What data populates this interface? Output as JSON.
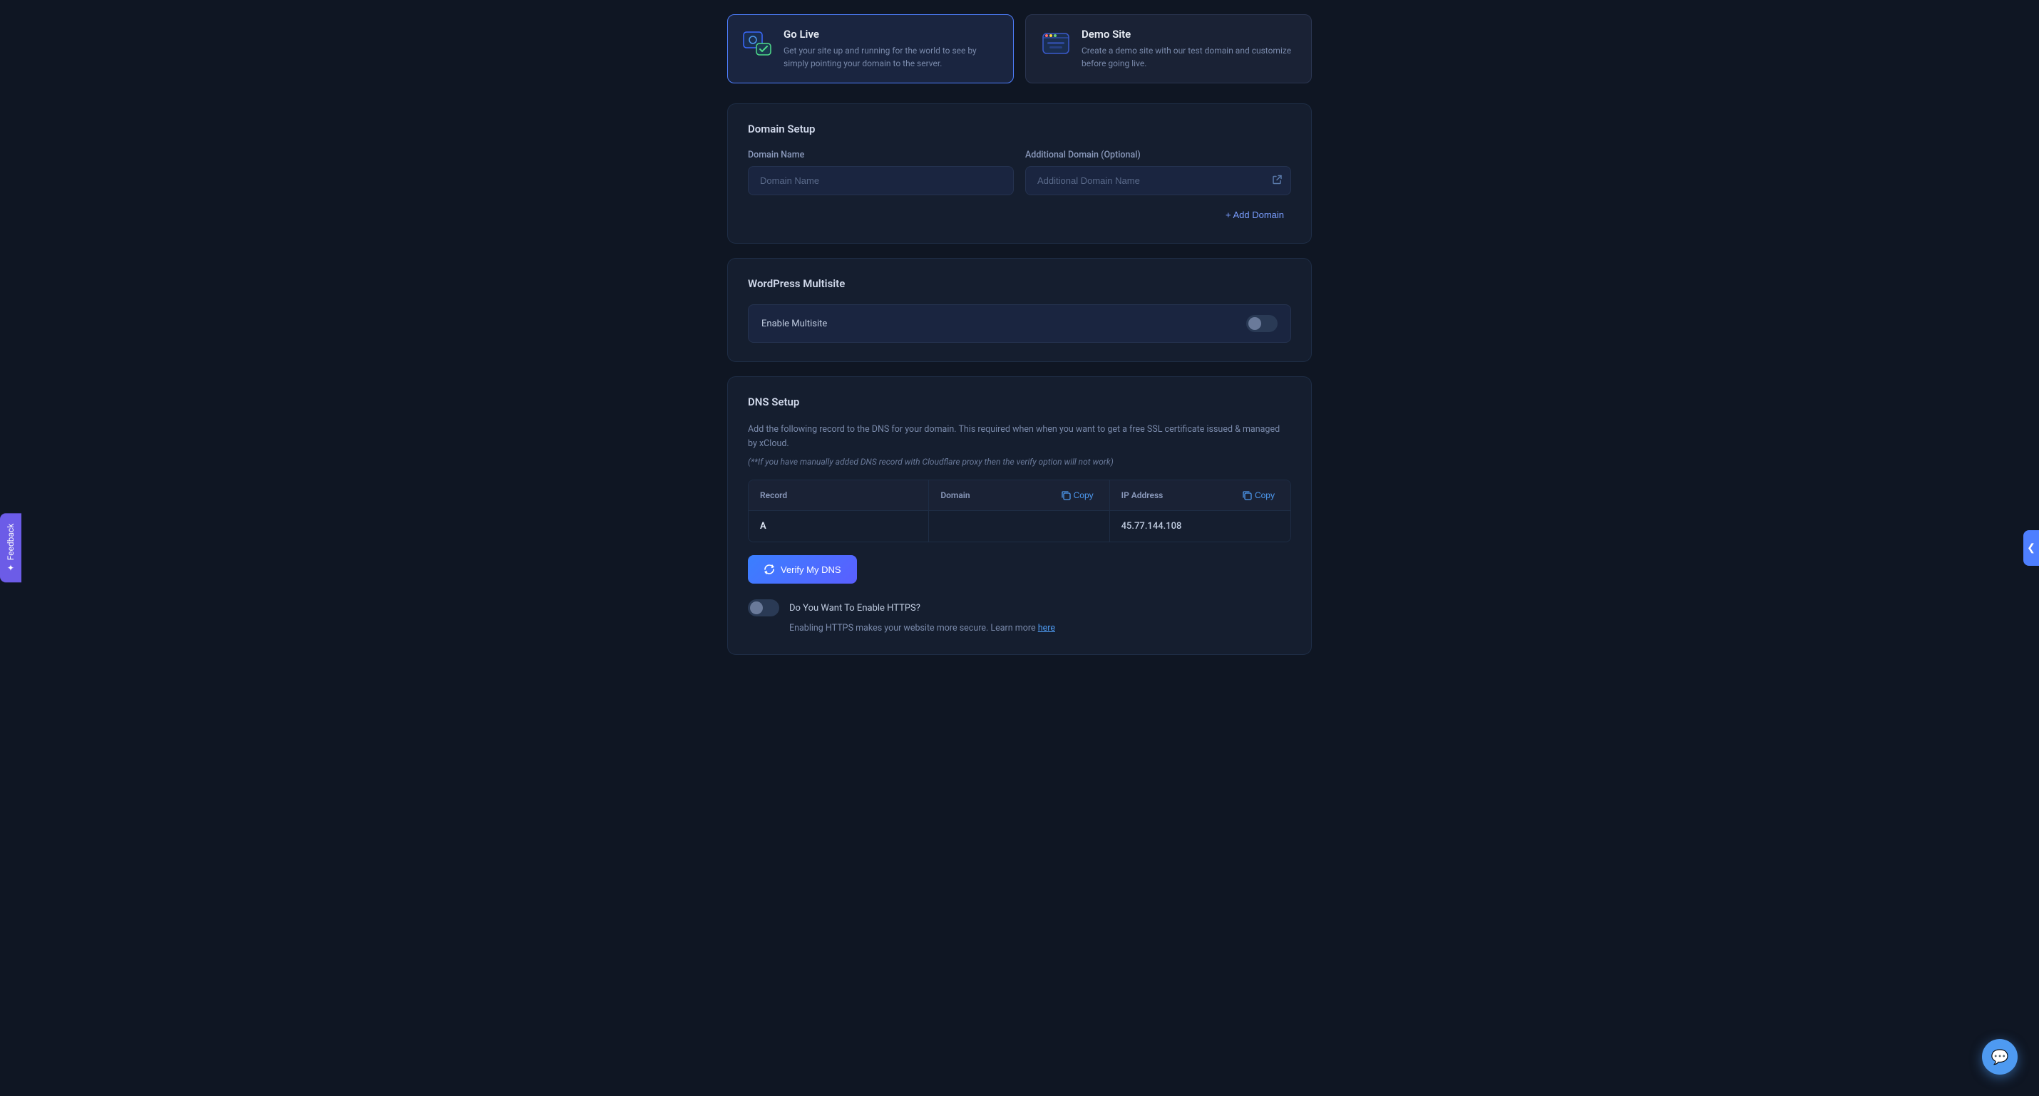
{
  "header": {
    "go_live_card": {
      "title": "Go Live",
      "description": "Get your site up and running for the world to see by simply pointing your domain to the server."
    },
    "demo_site_card": {
      "title": "Demo Site",
      "description": "Create a demo site with our test domain and customize before going live."
    }
  },
  "domain_setup": {
    "section_title": "Domain Setup",
    "domain_name_label": "Domain Name",
    "domain_name_placeholder": "Domain Name",
    "additional_domain_label": "Additional Domain (Optional)",
    "additional_domain_placeholder": "Additional Domain Name",
    "add_domain_btn": "+ Add Domain"
  },
  "wordpress_multisite": {
    "section_title": "WordPress Multisite",
    "enable_label": "Enable Multisite",
    "toggle_checked": false
  },
  "dns_setup": {
    "section_title": "DNS Setup",
    "description": "Add the following record to the DNS for your domain. This required when when you want to get a free SSL certificate issued & managed by xCloud.",
    "note": "(**If you have manually added DNS record with Cloudflare proxy then the verify option will not work)",
    "table": {
      "col_record": "Record",
      "col_domain": "Domain",
      "col_ip_address": "IP Address",
      "copy_label": "Copy",
      "record_value": "A",
      "domain_value": "",
      "ip_value": "45.77.144.108"
    },
    "verify_btn": "Verify My DNS",
    "https_toggle_checked": false,
    "https_label": "Do You Want To Enable HTTPS?",
    "https_description": "Enabling HTTPS makes your website more secure. Learn more",
    "https_link": "here"
  },
  "feedback": {
    "label": "✦ Feedback"
  },
  "collapse_btn": "❮",
  "chat_icon": "💬"
}
